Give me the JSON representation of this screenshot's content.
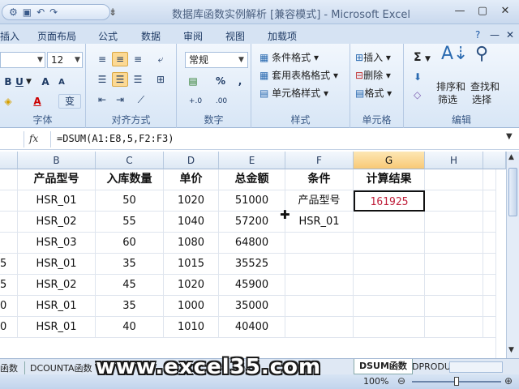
{
  "window": {
    "title": "数据库函数实例解析 [兼容模式] - Microsoft Excel",
    "controls": [
      "—",
      "▢",
      "✕"
    ]
  },
  "quick_access": {
    "icons": [
      "tools-icon",
      "save-icon",
      "undo-icon",
      "redo-icon"
    ],
    "separator": "⇟"
  },
  "ribbon_tabs": [
    "插入",
    "页面布局",
    "公式",
    "数据",
    "审阅",
    "视图",
    "加载项"
  ],
  "ribbon": {
    "font": {
      "size": "12",
      "label": "字体",
      "bold": "B",
      "underline": "U",
      "grow": "A",
      "shrink": "A",
      "font_color": "A",
      "phonetic": "变"
    },
    "alignment": {
      "label": "对齐方式"
    },
    "number": {
      "format": "常规",
      "label": "数字",
      "percent": "%",
      "comma": ",",
      "inc_decimal": "+.0",
      "dec_decimal": ".00"
    },
    "styles": {
      "label": "样式",
      "conditional": "条件格式",
      "table_format": "套用表格格式",
      "cell_styles": "单元格样式"
    },
    "cells": {
      "label": "单元格",
      "insert": "插入",
      "delete": "删除",
      "format": "格式"
    },
    "editing": {
      "label": "编辑",
      "sigma": "Σ",
      "sort_filter_1": "排序和",
      "sort_filter_2": "筛选",
      "find_1": "查找和",
      "find_2": "选择"
    }
  },
  "formula_bar": {
    "fx": "fx",
    "formula": "=DSUM(A1:E8,5,F2:F3)"
  },
  "columns": [
    "B",
    "C",
    "D",
    "E",
    "F",
    "G",
    "H"
  ],
  "selected_column": "G",
  "table": {
    "headers": [
      "产品型号",
      "入库数量",
      "单价",
      "总金额"
    ],
    "row_prefixes": [
      "",
      "",
      "",
      "5",
      "5",
      "0",
      "0"
    ],
    "rows": [
      [
        "HSR_01",
        "50",
        "1020",
        "51000"
      ],
      [
        "HSR_02",
        "55",
        "1040",
        "57200"
      ],
      [
        "HSR_03",
        "60",
        "1080",
        "64800"
      ],
      [
        "HSR_01",
        "35",
        "1015",
        "35525"
      ],
      [
        "HSR_02",
        "45",
        "1020",
        "45900"
      ],
      [
        "HSR_01",
        "35",
        "1000",
        "35000"
      ],
      [
        "HSR_01",
        "40",
        "1010",
        "40400"
      ]
    ]
  },
  "criteria": {
    "header": "条件",
    "field": "产品型号",
    "value": "HSR_01"
  },
  "result": {
    "header": "计算结果",
    "value": "161925",
    "color": "#c0203c"
  },
  "sheet_tabs": {
    "left_fragment": "函数",
    "tab1": "DCOUNTA函数",
    "active": "DSUM函数",
    "tab3": "DPRODU"
  },
  "status": {
    "zoom": "100%"
  },
  "watermark": "www.excel35.com"
}
